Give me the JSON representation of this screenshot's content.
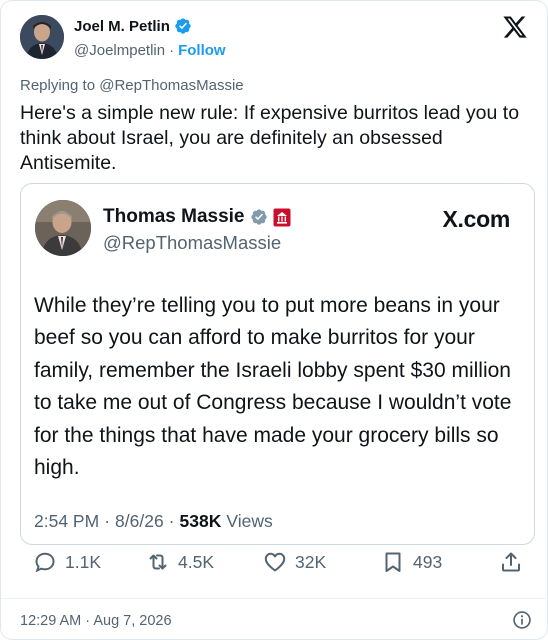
{
  "author": {
    "name": "Joel M. Petlin",
    "handle": "@Joelmpetlin",
    "separator": "·",
    "follow_label": "Follow"
  },
  "replying_to": "Replying to @RepThomasMassie",
  "tweet_text": "Here's a simple new rule: If expensive burritos lead you to think about Israel, you are definitely an obsessed Antisemite.",
  "quote": {
    "name": "Thomas Massie",
    "handle": "@RepThomasMassie",
    "site": "X.com",
    "text": "While they’re telling you to put more beans in your beef so you can afford to make burritos for your family, remember the Israeli lobby spent $30 million to take me out of Congress because I wouldn’t vote for the things that have made your grocery bills so high.",
    "time": "2:54 PM",
    "date": "8/6/26",
    "views_count": "538K",
    "views_label": "Views",
    "sep": "·"
  },
  "actions": {
    "replies": "1.1K",
    "reposts": "4.5K",
    "likes": "32K",
    "bookmarks": "493"
  },
  "timestamp": "12:29 AM · Aug 7, 2026",
  "icons": [
    "verified-badge-icon",
    "x-logo-icon",
    "house-seal-icon",
    "reply-icon",
    "repost-icon",
    "like-icon",
    "bookmark-icon",
    "share-icon",
    "info-icon"
  ],
  "colors": {
    "accent": "#1d9bf0",
    "verified_blue": "#1d9bf0",
    "verified_gray": "#829aab",
    "seal_red": "#c8102e",
    "secondary_text": "#536471"
  }
}
